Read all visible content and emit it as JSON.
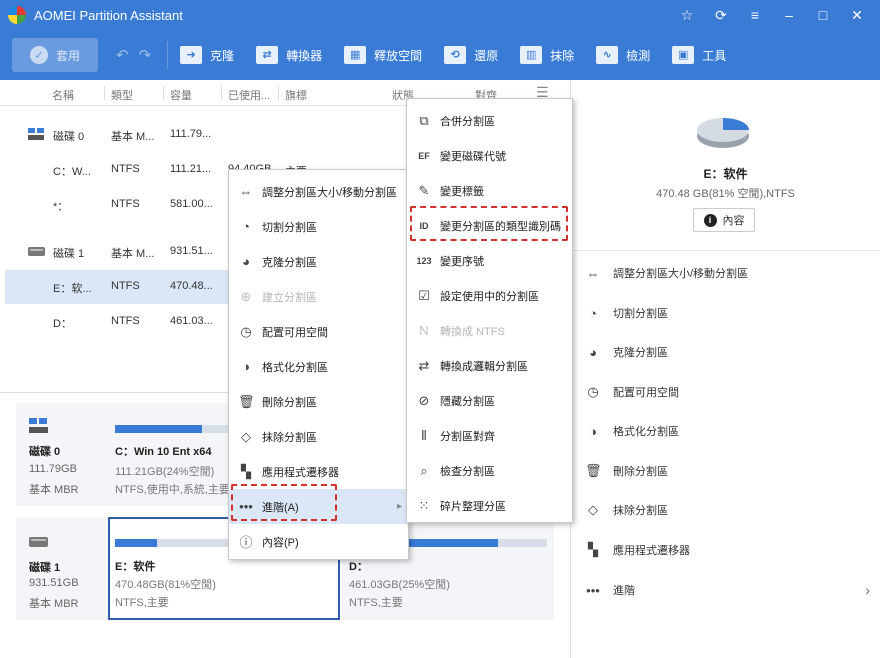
{
  "app": {
    "title": "AOMEI Partition Assistant",
    "window_controls": [
      "☆",
      "⟳",
      "≡",
      "–",
      "□",
      "✕"
    ]
  },
  "toolbar": {
    "apply": "套用",
    "buttons": [
      {
        "label": "克隆",
        "icon": "clone-icon"
      },
      {
        "label": "轉換器",
        "icon": "converter-icon"
      },
      {
        "label": "釋放空間",
        "icon": "free-space-icon"
      },
      {
        "label": "還原",
        "icon": "restore-icon"
      },
      {
        "label": "抹除",
        "icon": "wipe-icon"
      },
      {
        "label": "檢測",
        "icon": "test-icon"
      },
      {
        "label": "工具",
        "icon": "tools-icon"
      }
    ]
  },
  "columns": [
    "名稱",
    "類型",
    "容量",
    "已使用...",
    "旗標",
    "狀態",
    "對齊"
  ],
  "rows": [
    {
      "name": "磁碟 0",
      "type": "基本 M...",
      "capacity": "111.79..."
    },
    {
      "name": "C：W...",
      "type": "NTFS",
      "capacity": "111.21...",
      "used": "94.40GB",
      "flag": "主要"
    },
    {
      "name": "*：",
      "type": "NTFS",
      "capacity": "581.00..."
    },
    {
      "name": "磁碟 1",
      "type": "基本 M...",
      "capacity": "931.51..."
    },
    {
      "name": "E：软...",
      "type": "NTFS",
      "capacity": "470.48..."
    },
    {
      "name": "D：",
      "type": "NTFS",
      "capacity": "461.03..."
    }
  ],
  "diskmap": {
    "disk0": {
      "name": "磁碟 0",
      "size": "111.79GB",
      "style": "基本 MBR",
      "part": {
        "title": "C：Win 10 Ent x64",
        "line1": "111.21GB(24%空閒)",
        "line2": "NTFS,使用中,系統,主要",
        "used_fraction": 0.76
      }
    },
    "disk1": {
      "name": "磁碟 1",
      "size": "931.51GB",
      "style": "基本 MBR",
      "part_e": {
        "title": "E：软件",
        "line1": "470.48GB(81%空閒)",
        "line2": "NTFS,主要",
        "used_fraction": 0.19
      },
      "part_d": {
        "title": "D：",
        "line1": "461.03GB(25%空閒)",
        "line2": "NTFS,主要",
        "used_fraction": 0.75
      }
    }
  },
  "right_panel": {
    "title": "E：软件",
    "subtitle": "470.48 GB(81% 空閒),NTFS",
    "props_button": "內容",
    "items": [
      {
        "label": "調整分割區大小/移動分割區",
        "icon": "resize-icon"
      },
      {
        "label": "切割分割區",
        "icon": "split-icon"
      },
      {
        "label": "克隆分割區",
        "icon": "clone-partition-icon"
      },
      {
        "label": "配置可用空間",
        "icon": "allocate-icon"
      },
      {
        "label": "格式化分割區",
        "icon": "format-icon"
      },
      {
        "label": "刪除分割區",
        "icon": "trash-icon"
      },
      {
        "label": "抹除分割區",
        "icon": "eraser-icon"
      },
      {
        "label": "應用程式遷移器",
        "icon": "app-mover-icon"
      },
      {
        "label": "進階",
        "icon": "more-icon"
      }
    ]
  },
  "context_menu": {
    "items": [
      {
        "label": "調整分割區大小/移動分割區",
        "icon": "resize-icon",
        "disabled": false
      },
      {
        "label": "切割分割區",
        "icon": "split-icon",
        "disabled": false
      },
      {
        "label": "克隆分割區",
        "icon": "clone-partition-icon",
        "disabled": false
      },
      {
        "label": "建立分割區",
        "icon": "create-partition-icon",
        "disabled": true
      },
      {
        "label": "配置可用空間",
        "icon": "allocate-icon",
        "disabled": false
      },
      {
        "label": "格式化分割區",
        "icon": "format-icon",
        "disabled": false
      },
      {
        "label": "刪除分割區",
        "icon": "trash-icon",
        "disabled": false
      },
      {
        "label": "抹除分割區",
        "icon": "eraser-icon",
        "disabled": false
      },
      {
        "label": "應用程式遷移器",
        "icon": "app-mover-icon",
        "disabled": false
      },
      {
        "label": "進階(A)",
        "icon": "more-icon",
        "disabled": false
      },
      {
        "label": "內容(P)",
        "icon": "info-icon",
        "disabled": false
      }
    ]
  },
  "submenu": {
    "items": [
      {
        "label": "合併分割區",
        "icon": "merge-icon",
        "disabled": false
      },
      {
        "label": "變更磁碟代號",
        "icon": "drive-letter-icon",
        "disabled": false
      },
      {
        "label": "變更標籤",
        "icon": "pencil-icon",
        "disabled": false
      },
      {
        "label": "變更分割區的類型識別碼",
        "icon": "id-icon",
        "disabled": false
      },
      {
        "label": "變更序號",
        "icon": "serial-icon",
        "disabled": false
      },
      {
        "label": "設定使用中的分割區",
        "icon": "active-icon",
        "disabled": false
      },
      {
        "label": "轉換成 NTFS",
        "icon": "convert-ntfs-icon",
        "disabled": true
      },
      {
        "label": "轉換成邏輯分割區",
        "icon": "convert-logical-icon",
        "disabled": false
      },
      {
        "label": "隱藏分割區",
        "icon": "hide-icon",
        "disabled": false
      },
      {
        "label": "分割區對齊",
        "icon": "align-icon",
        "disabled": false
      },
      {
        "label": "檢查分割區",
        "icon": "search-icon",
        "disabled": false
      },
      {
        "label": "碎片整理分區",
        "icon": "defrag-icon",
        "disabled": false
      }
    ]
  },
  "colors": {
    "accent": "#3a7bd5",
    "selected_row": "#dbe7f6",
    "highlight_box": "#d0312d"
  }
}
